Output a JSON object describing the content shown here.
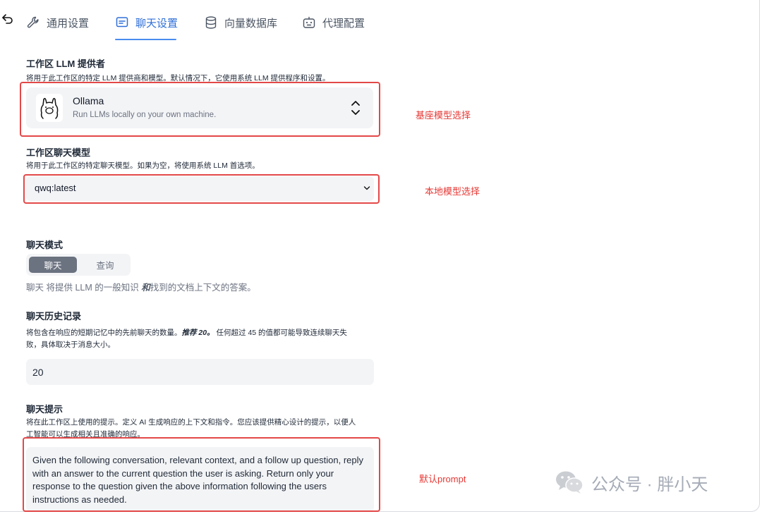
{
  "tabs": [
    {
      "label": "通用设置",
      "icon": "wrench-icon"
    },
    {
      "label": "聊天设置",
      "icon": "chat-icon"
    },
    {
      "label": "向量数据库",
      "icon": "database-icon"
    },
    {
      "label": "代理配置",
      "icon": "robot-icon"
    }
  ],
  "active_tab": "聊天设置",
  "llm_provider": {
    "title": "工作区 LLM 提供者",
    "description": "将用于此工作区的特定 LLM 提供商和模型。默认情况下，它使用系统 LLM 提供程序和设置。",
    "name": "Ollama",
    "subtitle": "Run LLMs locally on your own machine."
  },
  "chat_model": {
    "title": "工作区聊天模型",
    "description": "将用于此工作区的特定聊天模型。如果为空，将使用系统 LLM 首选项。",
    "value": "qwq:latest"
  },
  "chat_mode": {
    "title": "聊天模式",
    "options": [
      "聊天",
      "查询"
    ],
    "selected": "聊天",
    "desc_prefix": "聊天 将提供 LLM 的一般知识",
    "desc_emphasis": "和",
    "desc_suffix": "找到的文档上下文的答案。"
  },
  "chat_history": {
    "title": "聊天历史记录",
    "desc_line1_a": "将包含在响应的短期记忆中的先前聊天的数量。",
    "desc_line1_em": "推荐 20。",
    "desc_line1_b": " 任何超过 45 的值都可能导致连续聊天失",
    "desc_line2": "败，具体取决于消息大小。",
    "value": "20"
  },
  "chat_prompt": {
    "title": "聊天提示",
    "desc_line1": "将在此工作区上使用的提示。定义 AI 生成响应的上下文和指令。您应该提供精心设计的提示，以便人",
    "desc_line2": "工智能可以生成相关且准确的响应。",
    "value": "Given the following conversation, relevant context, and a follow up question, reply with an answer to the current question the user is asking. Return only your response to the question given the above information following the users instructions as needed."
  },
  "annotations": {
    "base_model": "基座模型选择",
    "local_model": "本地模型选择",
    "default_prompt": "默认prompt"
  },
  "watermark": "公众号 · 胖小天",
  "colors": {
    "accent": "#2f6fd8",
    "annotation": "#e53935",
    "field_bg": "#f3f4f6"
  }
}
